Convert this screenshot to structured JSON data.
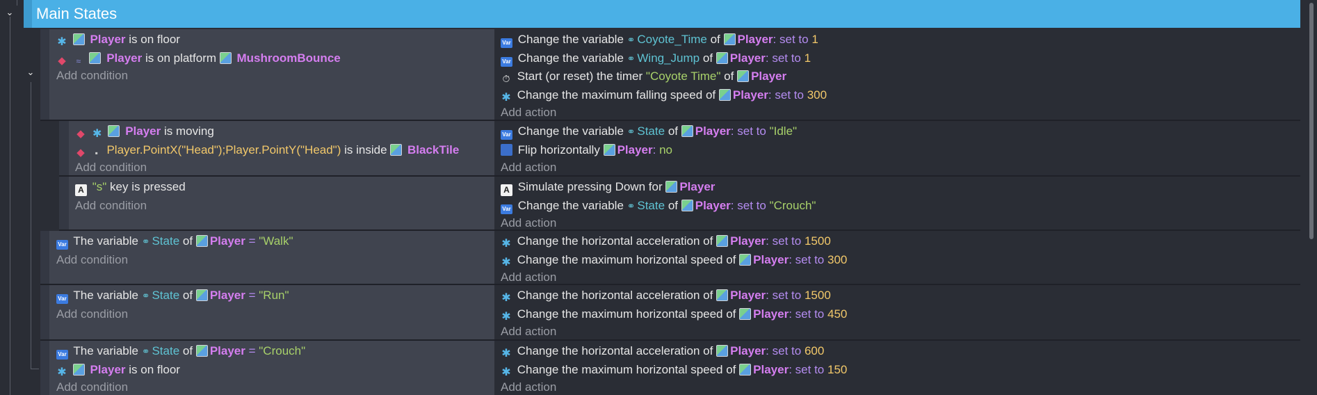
{
  "header": {
    "title": "Main States"
  },
  "words": {
    "player": "Player",
    "mushroom": "MushroomBounce",
    "blacktile": "BlackTile",
    "add_condition": "Add condition",
    "add_action": "Add action",
    "is_on_floor": "is on floor",
    "is_on_platform": "is on platform",
    "is_moving": "is moving",
    "is_inside": "is inside",
    "point_expr": "Player.PointX(\"Head\");Player.PointY(\"Head\")",
    "key_s": "\"s\"",
    "key_pressed": "key is pressed",
    "change_variable": "Change the variable",
    "of": "of",
    "colon": ":",
    "set_to": "set to",
    "start_timer": "Start (or reset) the timer",
    "coyote_timer_name": "\"Coyote Time\"",
    "change_max_fall": "Change the maximum falling speed of",
    "flip_h": "Flip horizontally",
    "no": "no",
    "simulate_down": "Simulate pressing Down for",
    "change_h_accel": "Change the horizontal acceleration of",
    "change_max_h_speed": "Change the maximum horizontal speed of",
    "the_variable": "The variable",
    "equals": "="
  },
  "vars": {
    "coyote": "Coyote_Time",
    "wing": "Wing_Jump",
    "state": "State"
  },
  "values": {
    "one": "1",
    "fall300": "300",
    "idle": "\"Idle\"",
    "crouch_str": "\"Crouch\"",
    "walk_str": "\"Walk\"",
    "run_str": "\"Run\"",
    "accel1500": "1500",
    "speed300": "300",
    "speed450": "450",
    "accel600": "600",
    "speed150": "150"
  }
}
